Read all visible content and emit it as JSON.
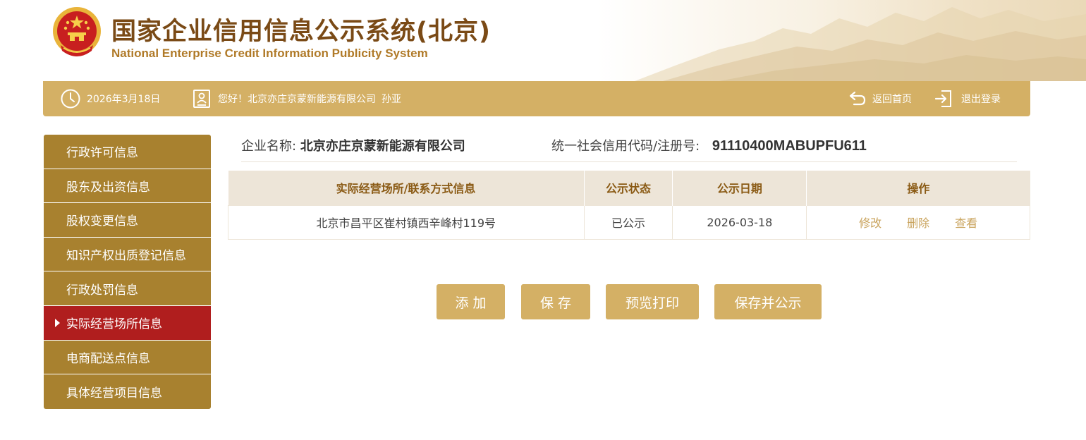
{
  "header": {
    "title_cn": "国家企业信用信息公示系统(北京)",
    "title_en": "National Enterprise Credit Information Publicity System"
  },
  "topbar": {
    "date": "2026年3月18日",
    "greeting": "您好！北京亦庄京蒙新能源有限公司",
    "user": "孙亚",
    "home_label": "返回首页",
    "logout_label": "退出登录"
  },
  "sidebar": {
    "items": [
      {
        "label": "行政许可信息"
      },
      {
        "label": "股东及出资信息"
      },
      {
        "label": "股权变更信息"
      },
      {
        "label": "知识产权出质登记信息"
      },
      {
        "label": "行政处罚信息"
      },
      {
        "label": "实际经营场所信息"
      },
      {
        "label": "电商配送点信息"
      },
      {
        "label": "具体经营项目信息"
      }
    ],
    "active_index": 5
  },
  "company": {
    "name_label": "企业名称:",
    "name": "北京亦庄京蒙新能源有限公司",
    "code_label": "统一社会信用代码/注册号:",
    "code": "91110400MABUPFU611"
  },
  "table": {
    "headers": [
      "实际经营场所/联系方式信息",
      "公示状态",
      "公示日期",
      "操作"
    ],
    "rows": [
      {
        "address": "北京市昌平区崔村镇西辛峰村119号",
        "status": "已公示",
        "date": "2026-03-18",
        "actions": [
          "修改",
          "删除",
          "查看"
        ]
      }
    ]
  },
  "buttons": {
    "add": "添 加",
    "save": "保 存",
    "print": "预览打印",
    "publish": "保存并公示"
  },
  "colors": {
    "gold": "#d4b065",
    "sidebar": "#a8812f",
    "active": "#b01e1e",
    "title": "#7a4a16"
  }
}
